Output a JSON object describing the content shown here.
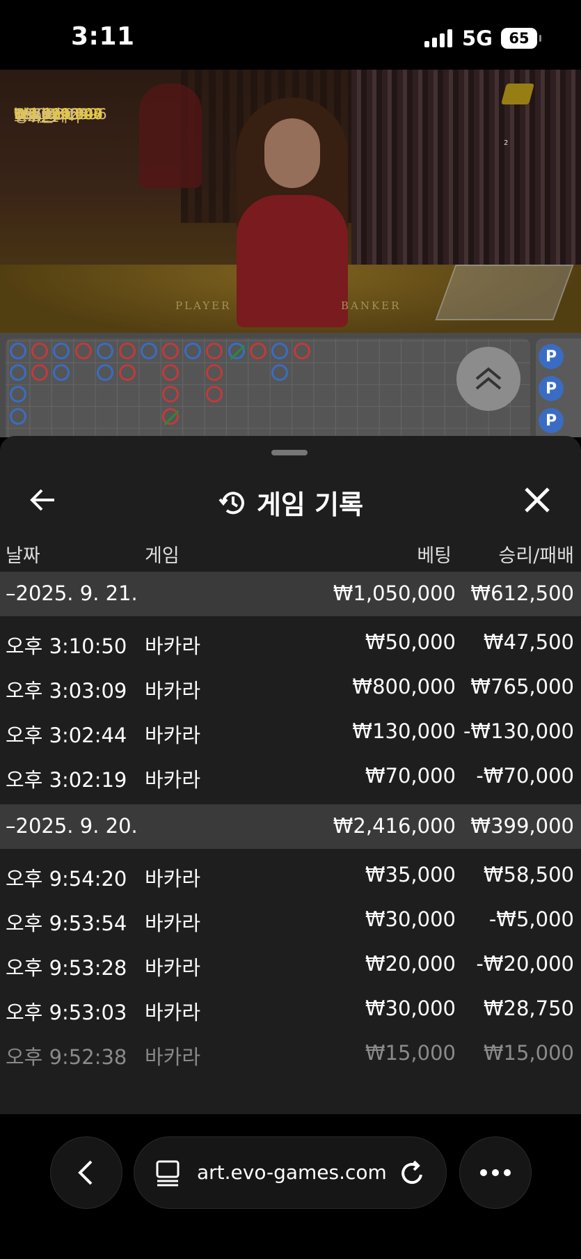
{
  "status_bar": {
    "time": "3:11",
    "network": "5G",
    "battery": "65"
  },
  "video": {
    "winners": [
      {
        "amount": "₩5,924,144",
        "name": "Kabil"
      },
      {
        "amount": "₩3,900,000",
        "name": "뱅커만패다"
      },
      {
        "amount": "₩2,390,097",
        "name": "1060196996"
      },
      {
        "amount": "₩2,390,097",
        "name": "18767924"
      },
      {
        "amount": "₩1,950,000",
        "name": "nhj0030"
      },
      {
        "amount": "₩1,200,000",
        "name": "baz_gi2650"
      },
      {
        "amount": "₩1,195,048",
        "name": "Ok"
      },
      {
        "amount": "₩1,111,500",
        "name": "고고21"
      }
    ],
    "table_label_player": "PLAYER",
    "table_label_banker": "BANKER",
    "corner_number": "2"
  },
  "side_road": {
    "badge": "P"
  },
  "history": {
    "title": "게임 기록",
    "columns": {
      "date": "날짜",
      "game": "게임",
      "bet": "베팅",
      "result": "승리/패배"
    },
    "groups": [
      {
        "date": "–2025. 9. 21.",
        "bet": "₩1,050,000",
        "result": "₩612,500",
        "rows": [
          {
            "time": "오후 3:10:50",
            "game": "바카라",
            "bet": "₩50,000",
            "result": "₩47,500"
          },
          {
            "time": "오후 3:03:09",
            "game": "바카라",
            "bet": "₩800,000",
            "result": "₩765,000"
          },
          {
            "time": "오후 3:02:44",
            "game": "바카라",
            "bet": "₩130,000",
            "result": "-₩130,000"
          },
          {
            "time": "오후 3:02:19",
            "game": "바카라",
            "bet": "₩70,000",
            "result": "-₩70,000"
          }
        ]
      },
      {
        "date": "–2025. 9. 20.",
        "bet": "₩2,416,000",
        "result": "₩399,000",
        "rows": [
          {
            "time": "오후 9:54:20",
            "game": "바카라",
            "bet": "₩35,000",
            "result": "₩58,500"
          },
          {
            "time": "오후 9:53:54",
            "game": "바카라",
            "bet": "₩30,000",
            "result": "-₩5,000"
          },
          {
            "time": "오후 9:53:28",
            "game": "바카라",
            "bet": "₩20,000",
            "result": "-₩20,000"
          },
          {
            "time": "오후 9:53:03",
            "game": "바카라",
            "bet": "₩30,000",
            "result": "₩28,750"
          },
          {
            "time": "오후 9:52:38",
            "game": "바카라",
            "bet": "₩15,000",
            "result": "₩15,000"
          }
        ]
      }
    ]
  },
  "browser": {
    "url": "art.evo-games.com"
  },
  "colors": {
    "player": "#3a6cc4",
    "banker": "#c23a3a",
    "tie": "#2a8a3a",
    "winner_text": "#e1c744"
  }
}
